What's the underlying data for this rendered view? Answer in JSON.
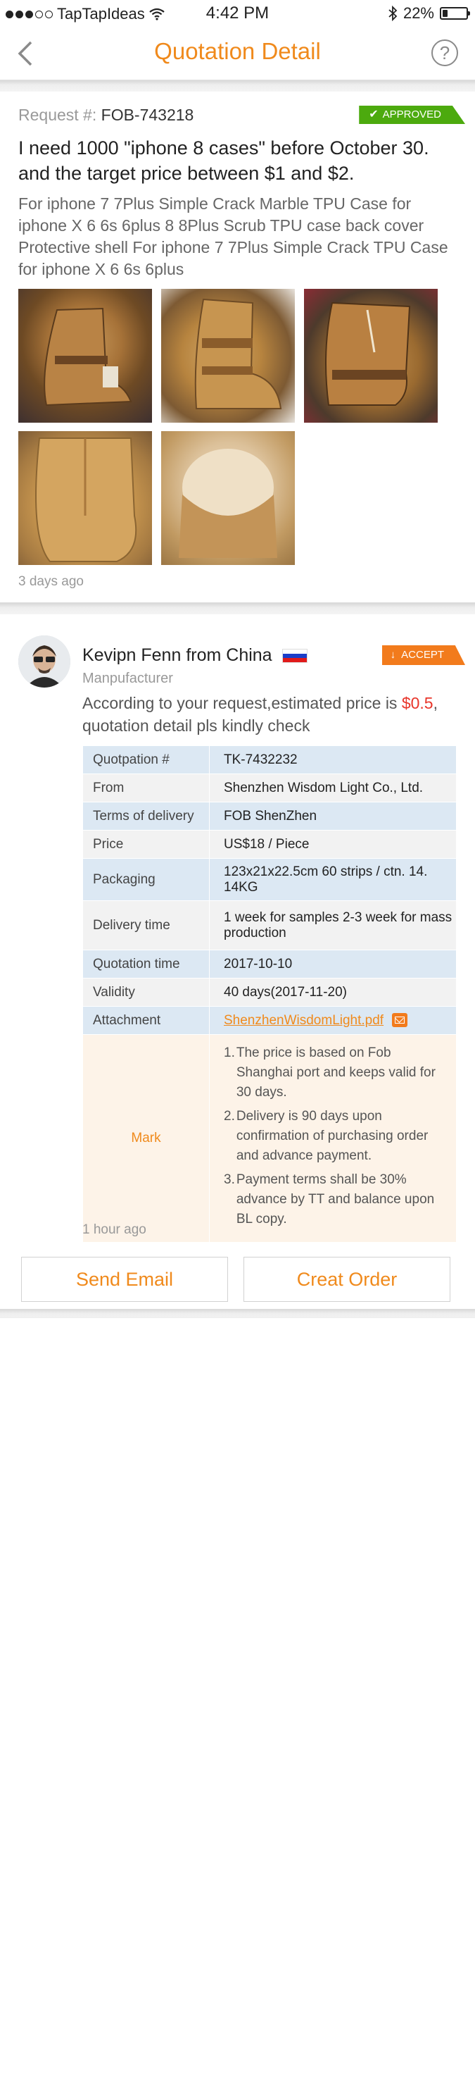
{
  "status_bar": {
    "carrier": "TapTapIdeas",
    "time": "4:42 PM",
    "battery": "22%",
    "battery_level": 0.22,
    "icons": [
      "signal-dots-icon",
      "wifi-icon",
      "bluetooth-icon",
      "battery-icon"
    ]
  },
  "nav": {
    "title": "Quotation Detail",
    "back_icon": "chevron-left-icon",
    "help_icon": "help-circle-icon",
    "help_glyph": "?"
  },
  "request": {
    "number_label": "Request #:",
    "number": "FOB-743218",
    "status": "APPROVED",
    "title": "I need 1000 \"iphone 8 cases\" before October 30. and the target price between $1 and $2.",
    "description": "For iphone 7 7Plus Simple Crack Marble TPU Case for iphone X 6 6s 6plus 8 8Plus Scrub TPU case back cover Protective shell For iphone 7 7Plus Simple Crack TPU Case  for iphone X 6 6s 6plus",
    "photos": [
      "boot-photo-1",
      "boot-photo-2",
      "boot-photo-3",
      "boot-photo-4",
      "boot-photo-5"
    ],
    "posted": "3 days ago"
  },
  "offer": {
    "seller_name": "Kevipn Fenn from China",
    "seller_role": "Manpufacturer",
    "status": "ACCEPT",
    "message_prefix": "According to your request,estimated price is ",
    "estimated_price": "$0.5",
    "message_suffix": ", quotation detail pls kindly check",
    "details": {
      "quotation_label": "Quotpation #",
      "quotation": "TK-7432232",
      "from_label": "From",
      "from": "Shenzhen Wisdom Light Co., Ltd.",
      "terms_label": "Terms of delivery",
      "terms": "FOB  ShenZhen",
      "price_label": "Price",
      "price": "US$18 / Piece",
      "packaging_label": "Packaging",
      "packaging": "123x21x22.5cm 60 strips / ctn. 14. 14KG",
      "delivery_label": "Delivery time",
      "delivery": "1 week for samples 2-3 week for mass production",
      "qtime_label": "Quotation time",
      "qtime": "2017-10-10",
      "validity_label": "Validity",
      "validity": "40 days(2017-11-20)",
      "attachment_label": "Attachment",
      "attachment": "ShenzhenWisdomLight.pdf",
      "mark_label": "Mark",
      "notes": [
        {
          "num": "1.",
          "text": "The price is based on Fob Shanghai port and keeps valid for 30 days."
        },
        {
          "num": "2.",
          "text": "Delivery is 90 days upon confirmation of purchasing order and advance payment."
        },
        {
          "num": "3.",
          "text": "Payment terms shall be 30% advance by TT and balance upon BL copy."
        }
      ]
    },
    "posted": "1 hour ago",
    "send_email": "Send Email",
    "create_order": "Creat Order"
  },
  "colors": {
    "accent": "#f08a1c",
    "approved": "#4caa0e",
    "accept": "#f27b1c",
    "price_red": "#e8352a",
    "table_blue": "#dce8f3",
    "table_gray": "#f2f2f2",
    "mark_bg": "#fdf3e8"
  }
}
